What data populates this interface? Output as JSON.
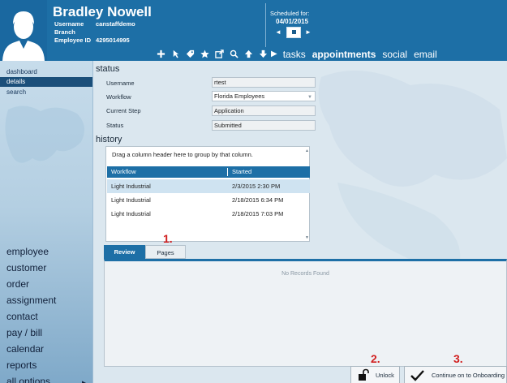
{
  "user": {
    "name": "Bradley Nowell",
    "username_label": "Username",
    "username_value": "canstaffdemo",
    "branch_label": "Branch",
    "employee_id_label": "Employee ID",
    "employee_id_value": "4295014995"
  },
  "schedule": {
    "label": "Scheduled for:",
    "date": "04/01/2015",
    "prev_icon": "◄",
    "next_icon": "►"
  },
  "toolbar_icons": [
    "plus-icon",
    "pointer-icon",
    "tag-icon",
    "star-icon",
    "external-link-icon",
    "search-icon",
    "arrow-up-icon",
    "arrow-down-icon"
  ],
  "top_nav": {
    "play_icon": "▶",
    "items": [
      {
        "label": "tasks",
        "active": false
      },
      {
        "label": "appointments",
        "active": true
      },
      {
        "label": "social",
        "active": false
      },
      {
        "label": "email",
        "active": false
      }
    ]
  },
  "side_nav": {
    "items": [
      {
        "label": "dashboard",
        "active": false
      },
      {
        "label": "details",
        "active": true
      },
      {
        "label": "search",
        "active": false
      }
    ]
  },
  "main_nav": {
    "items": [
      "employee",
      "customer",
      "order",
      "assignment",
      "contact",
      "pay / bill",
      "calendar",
      "reports",
      "all options"
    ],
    "more_icon": "▶"
  },
  "status": {
    "title": "status",
    "fields": [
      {
        "label": "Username",
        "value": "rtest"
      },
      {
        "label": "Workflow",
        "value": "Florida Employees"
      },
      {
        "label": "Current Step",
        "value": "Application"
      },
      {
        "label": "Status",
        "value": "Submitted"
      }
    ],
    "dropdown_icon": "▼"
  },
  "history": {
    "title": "history",
    "group_hint": "Drag a column header here to group by that column.",
    "columns": [
      "Workflow",
      "Started"
    ],
    "rows": [
      {
        "workflow": "Light Industrial",
        "started": "2/3/2015 2:30 PM"
      },
      {
        "workflow": "Light Industrial",
        "started": "2/18/2015 6:34 PM"
      },
      {
        "workflow": "Light Industrial",
        "started": "2/18/2015 7:03 PM"
      }
    ],
    "scroll_up": "▲",
    "scroll_down": "▼"
  },
  "tabs": [
    {
      "label": "Review",
      "active": true
    },
    {
      "label": "Pages",
      "active": false
    }
  ],
  "review_panel": {
    "empty_text": "No Records Found"
  },
  "markers": [
    "1.",
    "2.",
    "3."
  ],
  "actions": {
    "unlock_label": "Unlock",
    "continue_label": "Continue on to Onboarding"
  },
  "colors": {
    "header_blue": "#1d6fa6",
    "active_nav": "#1b4f7a",
    "marker_red": "#d11f1f"
  }
}
